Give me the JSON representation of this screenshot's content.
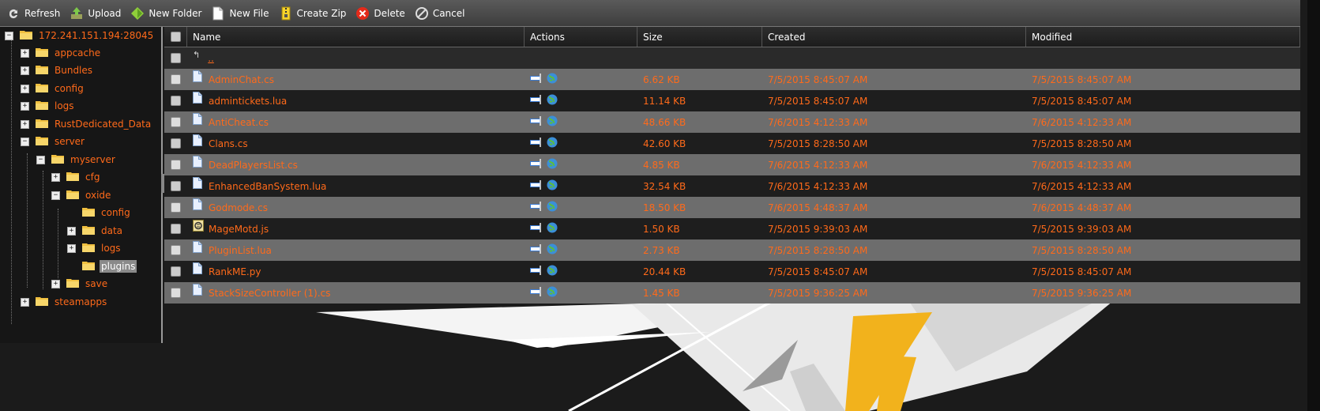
{
  "toolbar": {
    "refresh": {
      "label": "Refresh",
      "icon": "refresh-icon"
    },
    "upload": {
      "label": "Upload",
      "icon": "upload-icon"
    },
    "new_folder": {
      "label": "New Folder",
      "icon": "new-folder-icon"
    },
    "new_file": {
      "label": "New File",
      "icon": "new-file-icon"
    },
    "create_zip": {
      "label": "Create Zip",
      "icon": "zip-icon"
    },
    "delete": {
      "label": "Delete",
      "icon": "delete-icon"
    },
    "cancel": {
      "label": "Cancel",
      "icon": "cancel-icon"
    }
  },
  "tree": {
    "root": "172.241.151.194:28045",
    "items": [
      {
        "label": "appcache",
        "expander": "+"
      },
      {
        "label": "Bundles",
        "expander": "+"
      },
      {
        "label": "config",
        "expander": "+"
      },
      {
        "label": "logs",
        "expander": "+"
      },
      {
        "label": "RustDedicated_Data",
        "expander": "+"
      },
      {
        "label": "server",
        "expander": "−"
      },
      {
        "label": "myserver",
        "expander": "−"
      },
      {
        "label": "cfg",
        "expander": "+"
      },
      {
        "label": "oxide",
        "expander": "−"
      },
      {
        "label": "config",
        "expander": ""
      },
      {
        "label": "data",
        "expander": "+"
      },
      {
        "label": "logs",
        "expander": "+"
      },
      {
        "label": "plugins",
        "expander": "",
        "selected": true
      },
      {
        "label": "save",
        "expander": "+"
      },
      {
        "label": "steamapps",
        "expander": "+"
      }
    ]
  },
  "grid": {
    "columns": {
      "name": "Name",
      "actions": "Actions",
      "size": "Size",
      "created": "Created",
      "modified": "Modified"
    },
    "parent_row": {
      "label": "..",
      "icon": "up-arrow-icon"
    },
    "rows": [
      {
        "name": "AdminChat.cs",
        "size": "6.62 KB",
        "created": "7/5/2015 8:45:07 AM",
        "modified": "7/5/2015 8:45:07 AM",
        "icon": "file-icon"
      },
      {
        "name": "admintickets.lua",
        "size": "11.14 KB",
        "created": "7/5/2015 8:45:07 AM",
        "modified": "7/5/2015 8:45:07 AM",
        "icon": "file-icon"
      },
      {
        "name": "AntiCheat.cs",
        "size": "48.66 KB",
        "created": "7/6/2015 4:12:33 AM",
        "modified": "7/6/2015 4:12:33 AM",
        "icon": "file-icon"
      },
      {
        "name": "Clans.cs",
        "size": "42.60 KB",
        "created": "7/5/2015 8:28:50 AM",
        "modified": "7/5/2015 8:28:50 AM",
        "icon": "file-icon"
      },
      {
        "name": "DeadPlayersList.cs",
        "size": "4.85 KB",
        "created": "7/6/2015 4:12:33 AM",
        "modified": "7/6/2015 4:12:33 AM",
        "icon": "file-icon"
      },
      {
        "name": "EnhancedBanSystem.lua",
        "size": "32.54 KB",
        "created": "7/6/2015 4:12:33 AM",
        "modified": "7/6/2015 4:12:33 AM",
        "icon": "file-icon"
      },
      {
        "name": "Godmode.cs",
        "size": "18.50 KB",
        "created": "7/6/2015 4:48:37 AM",
        "modified": "7/6/2015 4:48:37 AM",
        "icon": "file-icon"
      },
      {
        "name": "MageMotd.js",
        "size": "1.50 KB",
        "created": "7/5/2015 9:39:03 AM",
        "modified": "7/5/2015 9:39:03 AM",
        "icon": "js-file-icon"
      },
      {
        "name": "PluginList.lua",
        "size": "2.73 KB",
        "created": "7/5/2015 8:28:50 AM",
        "modified": "7/5/2015 8:28:50 AM",
        "icon": "file-icon"
      },
      {
        "name": "RankME.py",
        "size": "20.44 KB",
        "created": "7/5/2015 8:45:07 AM",
        "modified": "7/5/2015 8:45:07 AM",
        "icon": "file-icon"
      },
      {
        "name": "StackSizeController (1).cs",
        "size": "1.45 KB",
        "created": "7/5/2015 9:36:25 AM",
        "modified": "7/5/2015 9:36:25 AM",
        "icon": "file-icon"
      }
    ]
  },
  "colors": {
    "accent": "#ff6a1a",
    "row_alt": "#6d6d6d",
    "row_dark": "#1e1e1e",
    "background": "#1a1a1a"
  }
}
